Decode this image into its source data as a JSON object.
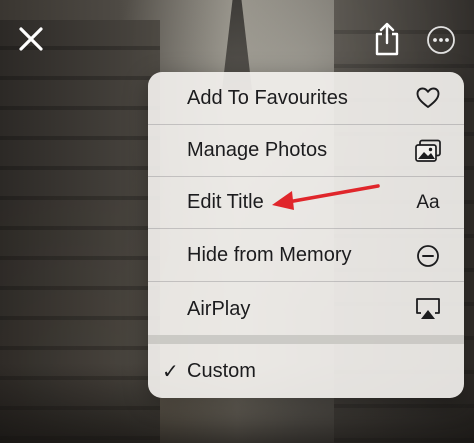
{
  "toolbar": {
    "close_icon": "close-icon",
    "share_icon": "share-icon",
    "more_icon": "ellipsis-circle-icon"
  },
  "menu": {
    "items": [
      {
        "label": "Add To Favourites",
        "icon": "heart-icon"
      },
      {
        "label": "Manage Photos",
        "icon": "photos-stack-icon"
      },
      {
        "label": "Edit Title",
        "icon_text": "Aa"
      },
      {
        "label": "Hide from Memory",
        "icon": "minus-circle-icon"
      },
      {
        "label": "AirPlay",
        "icon": "airplay-icon"
      }
    ],
    "custom": {
      "checkmark": "✓",
      "label": "Custom"
    }
  },
  "annotation": {
    "arrow_color": "#e0262b"
  }
}
